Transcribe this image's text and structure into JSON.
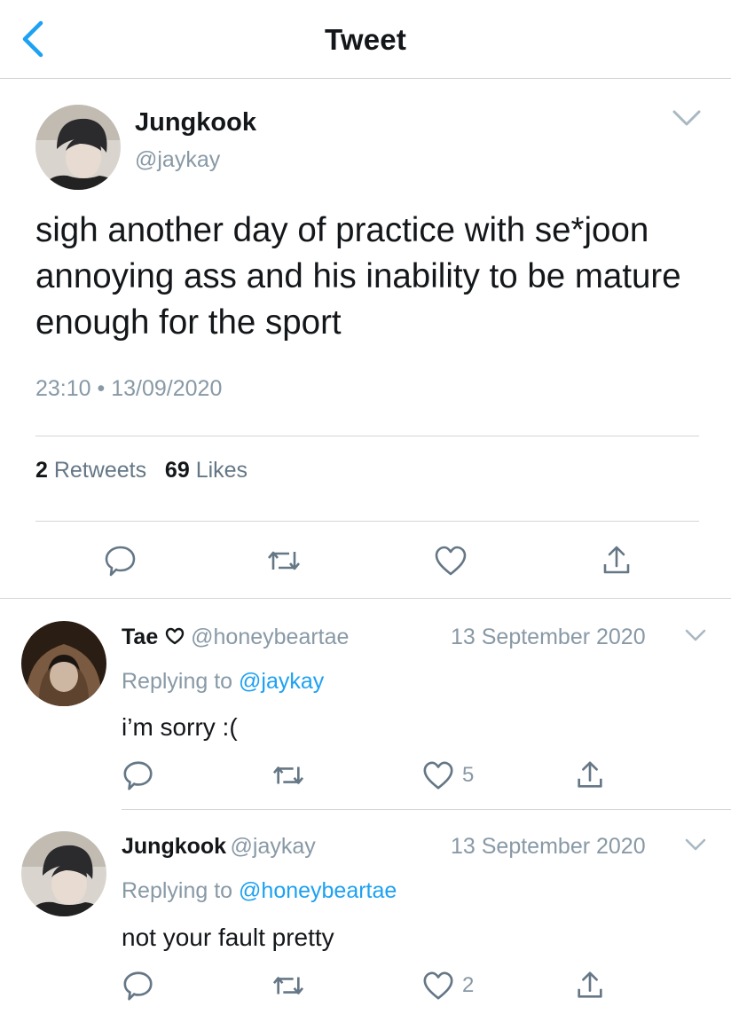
{
  "header": {
    "title": "Tweet"
  },
  "tweet": {
    "author_name": "Jungkook",
    "author_handle": "@jaykay",
    "text": "sigh another day of practice with se*joon annoying ass and his inability to be mature enough for the sport",
    "time": "23:10",
    "separator": "•",
    "date": "13/09/2020",
    "retweets_count": "2",
    "retweets_label": "Retweets",
    "likes_count": "69",
    "likes_label": "Likes"
  },
  "replies": [
    {
      "author_name": "Tae",
      "author_handle": "@honeybeartae",
      "date": "13 September 2020",
      "replying_prefix": "Replying to",
      "replying_to": "@jaykay",
      "text": "i’m sorry :(",
      "like_count": "5"
    },
    {
      "author_name": "Jungkook",
      "author_handle": "@jaykay",
      "date": "13 September 2020",
      "replying_prefix": "Replying to",
      "replying_to": "@honeybeartae",
      "text": "not your fault pretty",
      "like_count": "2"
    }
  ],
  "colors": {
    "accent": "#1da1f2",
    "secondary_text": "#8899a6",
    "divider": "#d6d6d6"
  },
  "icons": [
    "back-chevron-icon",
    "chevron-down-icon",
    "reply-icon",
    "retweet-icon",
    "heart-icon",
    "share-icon"
  ]
}
